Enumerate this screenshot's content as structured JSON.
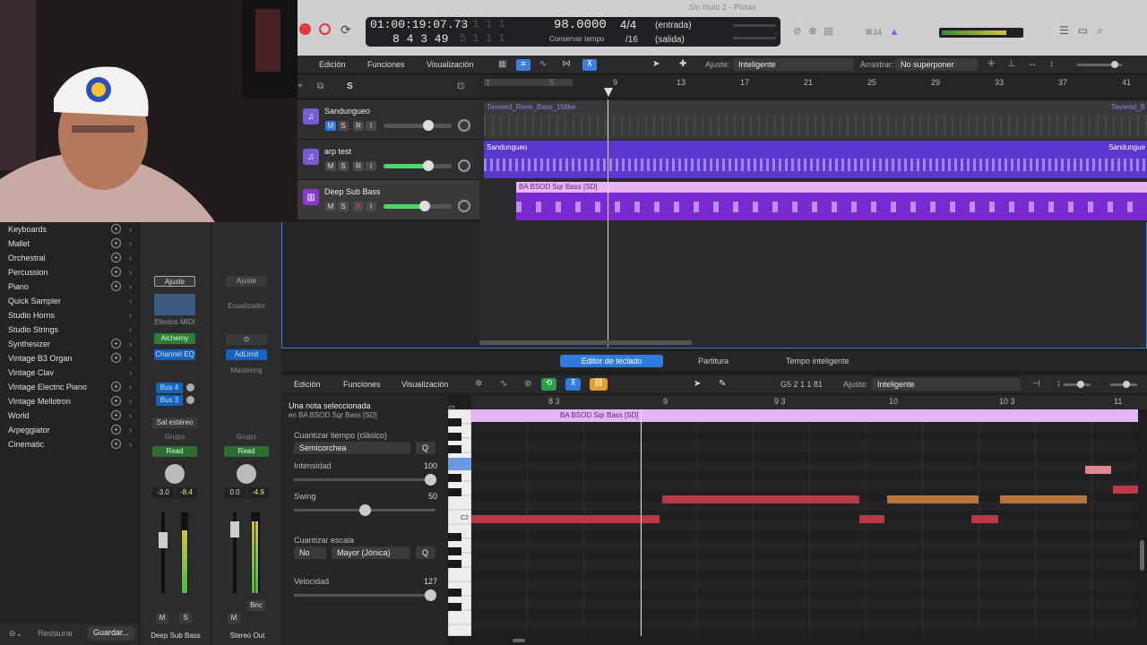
{
  "window": {
    "title": "Sin título 2 - Pistas"
  },
  "lcd": {
    "time": "01:00:19:07.73",
    "time_dim": "1 1 1  1",
    "bars": "8  4  3  49",
    "bars_dim": "5  1  1  1",
    "tempo": "98.0000",
    "tempo_label": "Conservar tempo",
    "signature": "4/4",
    "division": "/16",
    "input": "(entrada)",
    "output": "(salida)"
  },
  "toolbar_right": {
    "count_label": "⌘34"
  },
  "arrange": {
    "menus": [
      "Edición",
      "Funciones",
      "Visualización"
    ],
    "snap_label": "Ajuste:",
    "snap_value": "Inteligente",
    "drag_label": "Arrastrar:",
    "drag_value": "No superponer",
    "s_button": "S",
    "ruler_ticks": [
      "1",
      "5",
      "9",
      "13",
      "17",
      "21",
      "25",
      "29",
      "33",
      "37",
      "41"
    ],
    "tracks": [
      {
        "name": "Sandungueo",
        "m": "M",
        "s": "S",
        "r": "R",
        "i": "I",
        "volume": 0.82
      },
      {
        "name": "arp test",
        "m": "M",
        "s": "S",
        "r": "R",
        "i": "I",
        "volume": 0.82
      },
      {
        "name": "Deep Sub Bass",
        "m": "M",
        "s": "S",
        "r": "R",
        "i": "I",
        "volume": 0.76
      }
    ],
    "regions": [
      {
        "name": "Tavreed_Rees_Bass_1Mike",
        "end_name": "Tavreed_B"
      },
      {
        "name": "Sandungueo",
        "end_name": "Sandungue"
      },
      {
        "name": "BA BSOD Sqr Bass [SD]"
      }
    ]
  },
  "library": {
    "items": [
      {
        "label": "Keyboards",
        "plus": true
      },
      {
        "label": "Mallet",
        "plus": true
      },
      {
        "label": "Orchestral",
        "plus": true
      },
      {
        "label": "Percussion",
        "plus": true
      },
      {
        "label": "Piano",
        "plus": true
      },
      {
        "label": "Quick Sampler",
        "plus": false
      },
      {
        "label": "Studio Horns",
        "plus": false
      },
      {
        "label": "Studio Strings",
        "plus": false
      },
      {
        "label": "Synthesizer",
        "plus": true
      },
      {
        "label": "Vintage B3 Organ",
        "plus": true
      },
      {
        "label": "Vintage Clav",
        "plus": false
      },
      {
        "label": "Vintage Electric Piano",
        "plus": true
      },
      {
        "label": "Vintage Mellotron",
        "plus": true
      },
      {
        "label": "World",
        "plus": true
      },
      {
        "label": "Arpeggiator",
        "plus": true
      },
      {
        "label": "Cinematic",
        "plus": true
      }
    ],
    "restore": "Restaurar",
    "save": "Guardar..."
  },
  "mixer": {
    "strip1": {
      "setting": "Ajuste",
      "midi_fx": "Efectos MIDI",
      "instrument": "Alchemy",
      "eq": "Channel EQ",
      "bus4": "Bus 4",
      "bus3": "Bus 3",
      "output": "Sal estéreo",
      "group": "Grupo",
      "read": "Read",
      "pan_value": "-3.0",
      "level_value": "-8.4",
      "m": "M",
      "s": "S",
      "name": "Deep Sub Bass"
    },
    "strip2": {
      "setting": "Ajuste",
      "eq_label": "Ecualizador",
      "limiter": "AdLimit",
      "mastering": "Mastering",
      "group": "Grupo",
      "read": "Read",
      "pan_value": "0.0",
      "level_value": "-4.9",
      "m": "M",
      "bnc": "Bnc",
      "name": "Stereo Out"
    }
  },
  "piano_roll": {
    "tabs": [
      "Editor de teclado",
      "Partitura",
      "Tempo inteligente"
    ],
    "menus": [
      "Edición",
      "Funciones",
      "Visualización"
    ],
    "position": "G5   2 1 1 81",
    "snap_label": "Ajuste:",
    "snap_value": "Inteligente",
    "ruler_ticks": [
      "8 3",
      "9",
      "9 3",
      "10",
      "10 3",
      "11"
    ],
    "region_name": "BA BSOD Sqr Bass [SD]",
    "key_label": "C2",
    "inspector": {
      "title": "Una nota seleccionada",
      "subtitle": "en BA BSOD Sqr Bass [SD]",
      "quantize_label": "Cuantizar tiempo (clásico)",
      "quantize_value": "Semicorchea",
      "q_button": "Q",
      "strength_label": "Intensidad",
      "strength_value": "100",
      "swing_label": "Swing",
      "swing_value": "50",
      "scale_label": "Cuantizar escala",
      "scale_no": "No",
      "scale_value": "Mayor (Jónica)",
      "velocity_label": "Velocidad",
      "velocity_value": "127"
    }
  },
  "colors": {
    "accent": "#3e7ee0",
    "track_purple": "#6a40d8",
    "note_red": "#b83a44",
    "note_orange": "#b8743a",
    "region_pink": "#e5b6f3"
  }
}
